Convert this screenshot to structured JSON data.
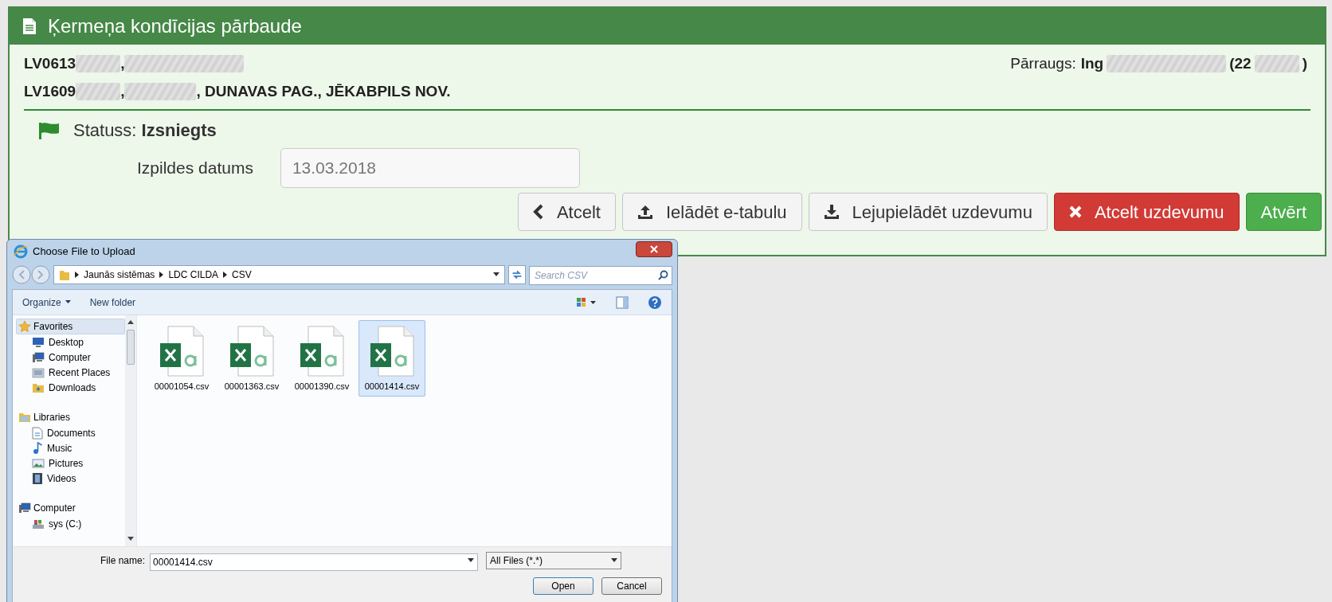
{
  "panel": {
    "title": "Ķermeņa kondīcijas pārbaude",
    "address_lines": [
      [
        {
          "kind": "text",
          "text": "LV0613"
        },
        {
          "kind": "redacted"
        },
        {
          "kind": "text",
          "text": ","
        },
        {
          "kind": "redacted"
        }
      ],
      [
        {
          "kind": "text",
          "text": "LV1609"
        },
        {
          "kind": "redacted"
        },
        {
          "kind": "text",
          "text": ","
        },
        {
          "kind": "redacted"
        },
        {
          "kind": "text",
          "text": ", DUNAVAS PAG., JĒKABPILS NOV."
        }
      ]
    ],
    "supervisor": [
      {
        "kind": "label",
        "text": "Pārraugs:"
      },
      {
        "kind": "text",
        "text": "Ing"
      },
      {
        "kind": "redacted"
      },
      {
        "kind": "text",
        "text": "(22"
      },
      {
        "kind": "redacted"
      },
      {
        "kind": "text",
        "text": ")"
      }
    ],
    "status": {
      "label": "Statuss:",
      "value": "Izsniegts"
    },
    "date_field": {
      "label": "Izpildes datums",
      "value": "13.03.2018"
    },
    "buttons": [
      {
        "label": "Atcelt",
        "kind": "default"
      },
      {
        "label": "Ielādēt e-tabulu",
        "kind": "default"
      },
      {
        "label": "Lejupielādēt uzdevumu",
        "kind": "default"
      },
      {
        "label": "Atcelt uzdevumu",
        "kind": "danger"
      },
      {
        "label": "Atvērt",
        "kind": "success"
      }
    ]
  },
  "dialog": {
    "title": "Choose File to Upload",
    "breadcrumb": [
      "Jaunās sistēmas",
      "LDC CILDA",
      "CSV"
    ],
    "search": {
      "placeholder": "Search CSV"
    },
    "toolbar": [
      {
        "label": "Organize",
        "dropdown": true
      },
      {
        "label": "New folder",
        "dropdown": false
      }
    ],
    "nav": [
      {
        "label": "Favorites",
        "selected": true,
        "children": [
          {
            "label": "Desktop",
            "selected": false
          },
          {
            "label": "Computer",
            "selected": false
          },
          {
            "label": "Recent Places",
            "selected": false
          },
          {
            "label": "Downloads",
            "selected": false
          }
        ]
      },
      {
        "label": "Libraries",
        "selected": false,
        "children": [
          {
            "label": "Documents",
            "selected": false
          },
          {
            "label": "Music",
            "selected": false
          },
          {
            "label": "Pictures",
            "selected": false
          },
          {
            "label": "Videos",
            "selected": false
          }
        ]
      },
      {
        "label": "Computer",
        "selected": false,
        "children": [
          {
            "label": "sys (C:)",
            "selected": false
          }
        ]
      }
    ],
    "files": [
      {
        "name": "00001054.csv",
        "selected": false
      },
      {
        "name": "00001363.csv",
        "selected": false
      },
      {
        "name": "00001390.csv",
        "selected": false
      },
      {
        "name": "00001414.csv",
        "selected": true
      }
    ],
    "file_name": {
      "label": "File name:",
      "value": "00001414.csv"
    },
    "file_type": "All Files (*.*)",
    "buttons": [
      "Open",
      "Cancel"
    ]
  }
}
